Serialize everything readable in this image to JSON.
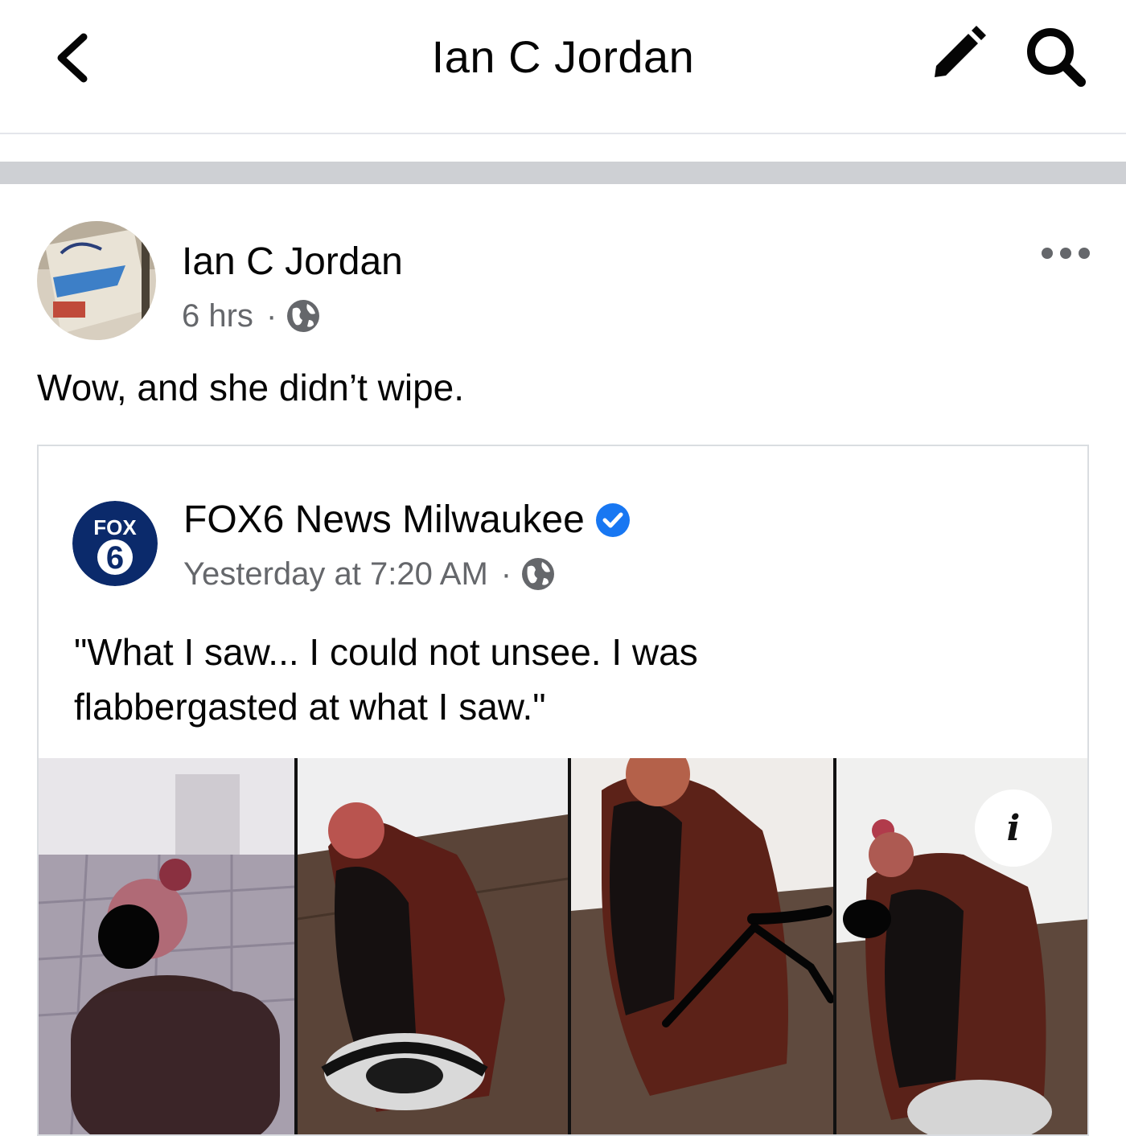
{
  "header": {
    "title": "Ian C Jordan",
    "back_icon": "chevron-left-icon",
    "edit_icon": "pencil-icon",
    "search_icon": "search-icon"
  },
  "post": {
    "author": "Ian C Jordan",
    "time": "6 hrs",
    "separator": "·",
    "audience_icon": "globe-icon",
    "more_icon": "more-horizontal-icon",
    "text": "Wow, and she didn’t wipe."
  },
  "shared_post": {
    "logo_text_top": "FOX",
    "logo_text_bottom": "6",
    "page_name": "FOX6 News Milwaukee",
    "verified_icon": "verified-badge-icon",
    "time": "Yesterday at 7:20 AM",
    "separator": "·",
    "audience_icon": "globe-icon",
    "text_line1": "\"What I saw... I could not unsee. I was",
    "text_line2": "flabbergasted at what I saw.\"",
    "info_label": "i"
  },
  "colors": {
    "text_primary": "#050505",
    "text_secondary": "#65676b",
    "divider": "#ced0d4",
    "verified_blue": "#1877f2",
    "fox_navy": "#0b2a6b"
  }
}
